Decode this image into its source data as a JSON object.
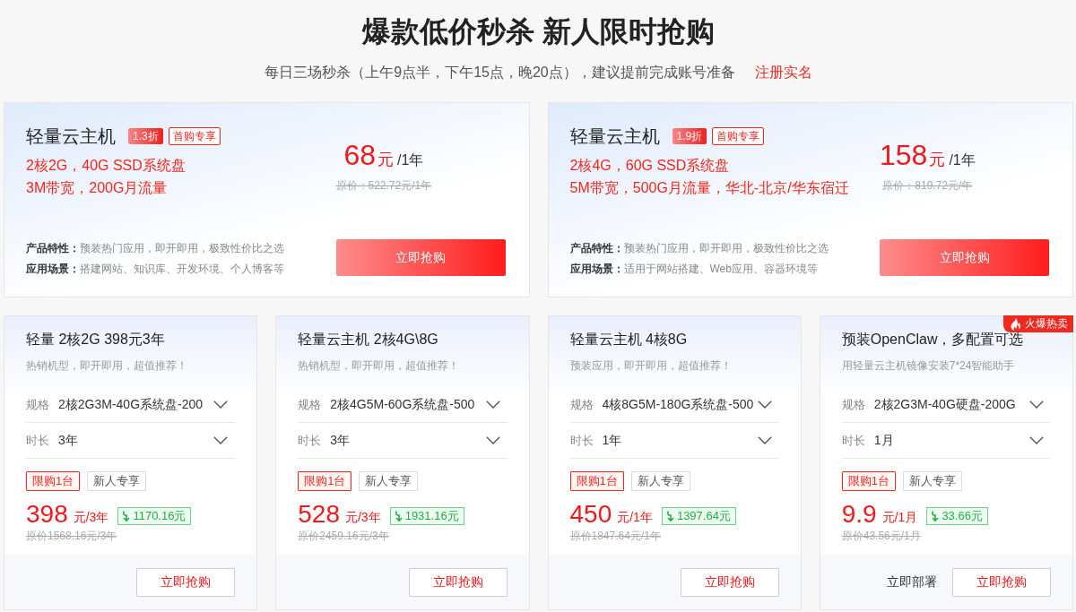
{
  "header": {
    "title": "爆款低价秒杀 新人限时抢购",
    "subtitle": "每日三场秒杀（上午9点半，下午15点，晚20点），建议提前完成账号准备",
    "link": "注册实名"
  },
  "featured_offers": [
    {
      "title": "轻量云主机",
      "discount": "1.3折",
      "tag": "首购专享",
      "specs": [
        "2核2G，40G SSD系统盘",
        "3M带宽，200G月流量"
      ],
      "price": "68",
      "currency": "元",
      "period": "/1年",
      "original_price": "原价：522.72元/1年",
      "features": [
        {
          "label": "产品特性：",
          "value": "预装热门应用，即开即用，极致性价比之选"
        },
        {
          "label": "应用场景：",
          "value": "搭建网站、知识库、开发环境、个人博客等"
        }
      ],
      "button": "立即抢购"
    },
    {
      "title": "轻量云主机",
      "discount": "1.9折",
      "tag": "首购专享",
      "specs": [
        "2核4G，60G SSD系统盘",
        "5M带宽，500G月流量，华北-北京/华东宿迁"
      ],
      "price": "158",
      "currency": "元",
      "period": "/1年",
      "original_price": "原价：819.72元/年",
      "features": [
        {
          "label": "产品特性：",
          "value": "预装热门应用，即开即用，极致性价比之选"
        },
        {
          "label": "应用场景：",
          "value": "适用于网站搭建、Web应用、容器环境等"
        }
      ],
      "button": "立即抢购"
    }
  ],
  "offers": [
    {
      "title": "轻量 2核2G 398元3年",
      "subtitle": "热销机型，即开即用，超值推荐！",
      "options": [
        {
          "label": "规格",
          "value": "2核2G3M-40G系统盘-200"
        },
        {
          "label": "时长",
          "value": "3年"
        }
      ],
      "tags": [
        {
          "kind": "limit",
          "text": "限购1台"
        },
        {
          "kind": "promo",
          "text": "新人专享"
        }
      ],
      "price": "398",
      "period": "元/3年",
      "saving": "1170.16元",
      "original_price": "原价1568.16元/3年",
      "button": "立即抢购"
    },
    {
      "title": "轻量云主机 2核4G\\8G",
      "subtitle": "热销机型，即开即用，超值推荐！",
      "options": [
        {
          "label": "规格",
          "value": "2核4G5M-60G系统盘-500"
        },
        {
          "label": "时长",
          "value": "3年"
        }
      ],
      "tags": [
        {
          "kind": "limit",
          "text": "限购1台"
        },
        {
          "kind": "promo",
          "text": "新人专享"
        }
      ],
      "price": "528",
      "period": "元/3年",
      "saving": "1931.16元",
      "original_price": "原价2459.16元/3年",
      "button": "立即抢购"
    },
    {
      "title": "轻量云主机 4核8G",
      "subtitle": "预装应用，即开即用，超值推荐！",
      "options": [
        {
          "label": "规格",
          "value": "4核8G5M-180G系统盘-500"
        },
        {
          "label": "时长",
          "value": "1年"
        }
      ],
      "tags": [
        {
          "kind": "limit",
          "text": "限购1台"
        },
        {
          "kind": "promo",
          "text": "新人专享"
        }
      ],
      "price": "450",
      "period": "元/1年",
      "saving": "1397.64元",
      "original_price": "原价1847.64元/1年",
      "button": "立即抢购"
    },
    {
      "title": "预装OpenClaw，多配置可选",
      "subtitle": "用轻量云主机镜像安装7*24智能助手",
      "ribbon": "火爆热卖",
      "options": [
        {
          "label": "规格",
          "value": "2核2G3M-40G硬盘-200G"
        },
        {
          "label": "时长",
          "value": "1月"
        }
      ],
      "tags": [
        {
          "kind": "limit",
          "text": "限购1台"
        },
        {
          "kind": "promo",
          "text": "新人专享"
        }
      ],
      "price": "9.9",
      "period": "元/1月",
      "saving": "33.66元",
      "original_price": "原价43.56元/1月",
      "secondary_action": "立即部署",
      "button": "立即抢购"
    }
  ]
}
